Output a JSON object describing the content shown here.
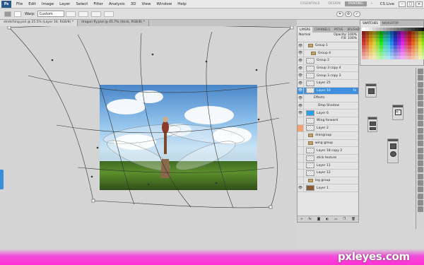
{
  "menubar": {
    "logo": "Ps",
    "items": [
      "File",
      "Edit",
      "Image",
      "Layer",
      "Select",
      "Filter",
      "Analysis",
      "3D",
      "View",
      "Window",
      "Help"
    ],
    "workspaces": [
      "ESSENTIALS",
      "DESIGN",
      "PAINTING"
    ],
    "cs_live": "CS Live"
  },
  "options": {
    "warp_label": "Warp:",
    "warp_value": "Custom"
  },
  "doc_tabs": [
    "stretching.psd @ 25.5% (Layer 16, RGB/8) *",
    "dragon fly.psd @ 45.7% (thick, RGB/8) *"
  ],
  "layers_panel": {
    "tabs": [
      "LAYERS",
      "CHANNELS",
      "PATHS",
      "BRUSHES"
    ],
    "blend_mode": "Normal",
    "opacity_label": "Opacity:",
    "opacity": "100%",
    "fill_label": "Fill:",
    "fill": "100%",
    "layers": [
      "Group 1",
      "Group 4",
      "Group 2",
      "Group 3 copy 4",
      "Group 3 copy 3",
      "Layer 25",
      "Layer 16",
      "Effects",
      "Drop Shadow",
      "Layer 6",
      "Wing forward",
      "Layer 2",
      "drongroup",
      "wing group",
      "Layer 18 copy 2",
      "stick texture",
      "Layer 11",
      "Layer 12",
      "leg group",
      "Layer 1"
    ]
  },
  "swatches": {
    "tabs": [
      "SWATCHES",
      "NAVIGATOR"
    ]
  },
  "watermark": "pxleyes.com",
  "colors": {
    "selected_layer": "#3d8fe0",
    "watermark_band": "#ff2fd5"
  }
}
